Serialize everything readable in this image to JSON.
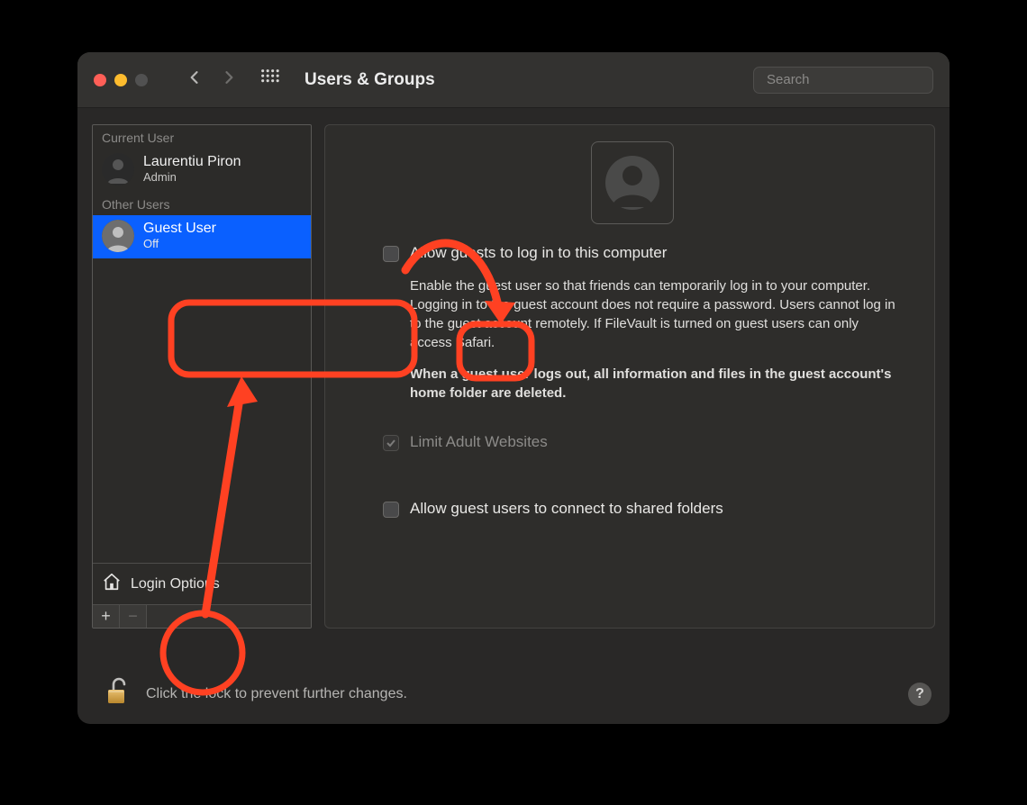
{
  "toolbar": {
    "title": "Users & Groups",
    "search_placeholder": "Search"
  },
  "sidebar": {
    "current_user_label": "Current User",
    "other_users_label": "Other Users",
    "users": [
      {
        "name": "Laurentiu Piron",
        "role": "Admin"
      },
      {
        "name": "Guest User",
        "role": "Off"
      }
    ],
    "login_options_label": "Login Options",
    "add_label": "+",
    "remove_label": "−"
  },
  "detail": {
    "allow_guests_label": "Allow guests to log in to this computer",
    "description_1": "Enable the guest user so that friends can temporarily log in to your computer. Logging in to the guest account does not require a password. Users cannot log in to the guest account remotely. If FileVault is turned on guest users can only access Safari.",
    "description_bold": "When a guest user logs out, all information and files in the guest account's home folder are deleted.",
    "limit_adult_label": "Limit Adult Websites",
    "allow_shared_label": "Allow guest users to connect to shared folders"
  },
  "footer": {
    "lock_text": "Click the lock to prevent further changes.",
    "help_label": "?"
  }
}
